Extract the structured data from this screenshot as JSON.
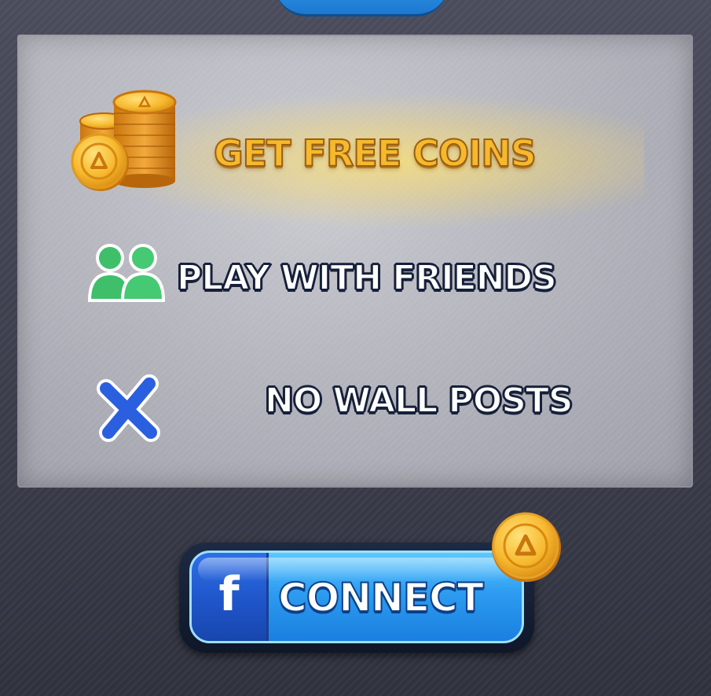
{
  "rewards": {
    "free_coins": "GET FREE COINS",
    "play_with_friends": "PLAY WITH FRIENDS",
    "no_wall_posts": "NO WALL POSTS"
  },
  "connect_button": {
    "fb_glyph": "f",
    "label": "CONNECT"
  },
  "icons": {
    "coins": "coin-stack-icon",
    "friends": "friends-icon",
    "no_posts": "x-mark-icon",
    "badge": "coin-badge-icon",
    "facebook": "facebook-icon"
  },
  "colors": {
    "accent_gold": "#f5b92d",
    "button_blue": "#2d9cf0",
    "facebook_blue": "#1f55c9",
    "friends_green": "#3fbf6a",
    "x_blue": "#2a5fe0"
  }
}
